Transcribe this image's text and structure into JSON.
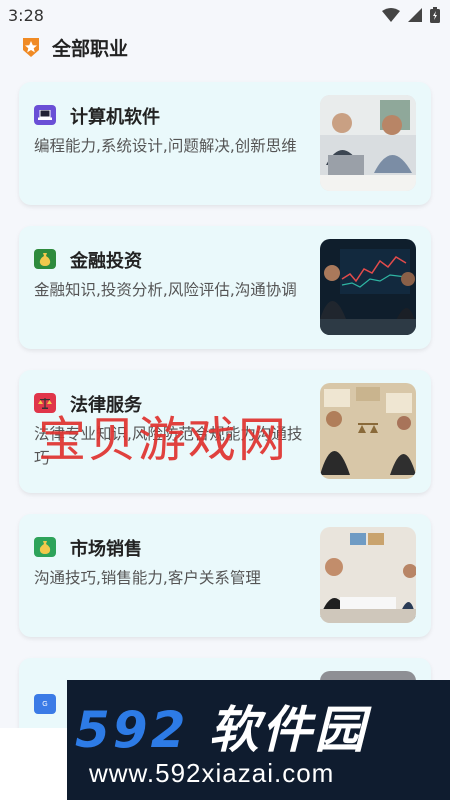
{
  "status_bar": {
    "time": "3:28"
  },
  "header": {
    "title": "全部职业"
  },
  "cards": [
    {
      "title": "计算机软件",
      "desc": "编程能力,系统设计,问题解决,创新思维",
      "icon": "laptop-icon",
      "icon_color": "#6a4fd6"
    },
    {
      "title": "金融投资",
      "desc": "金融知识,投资分析,风险评估,沟通协调",
      "icon": "money-bag-icon",
      "icon_color": "#2e8b3d"
    },
    {
      "title": "法律服务",
      "desc": "法律专业知识,风险防范合规能力沟通技巧",
      "icon": "scales-icon",
      "icon_color": "#e0364a"
    },
    {
      "title": "市场销售",
      "desc": "沟通技巧,销售能力,客户关系管理",
      "icon": "money-bag-icon",
      "icon_color": "#2ea35a"
    },
    {
      "title": "",
      "desc": "",
      "icon": "gpt-icon",
      "icon_color": "#3b7be6"
    }
  ],
  "watermark": {
    "text": "宝贝游戏网"
  },
  "banner": {
    "numbers": "592",
    "name": "软件园",
    "url": "www.592xiazai.com"
  }
}
